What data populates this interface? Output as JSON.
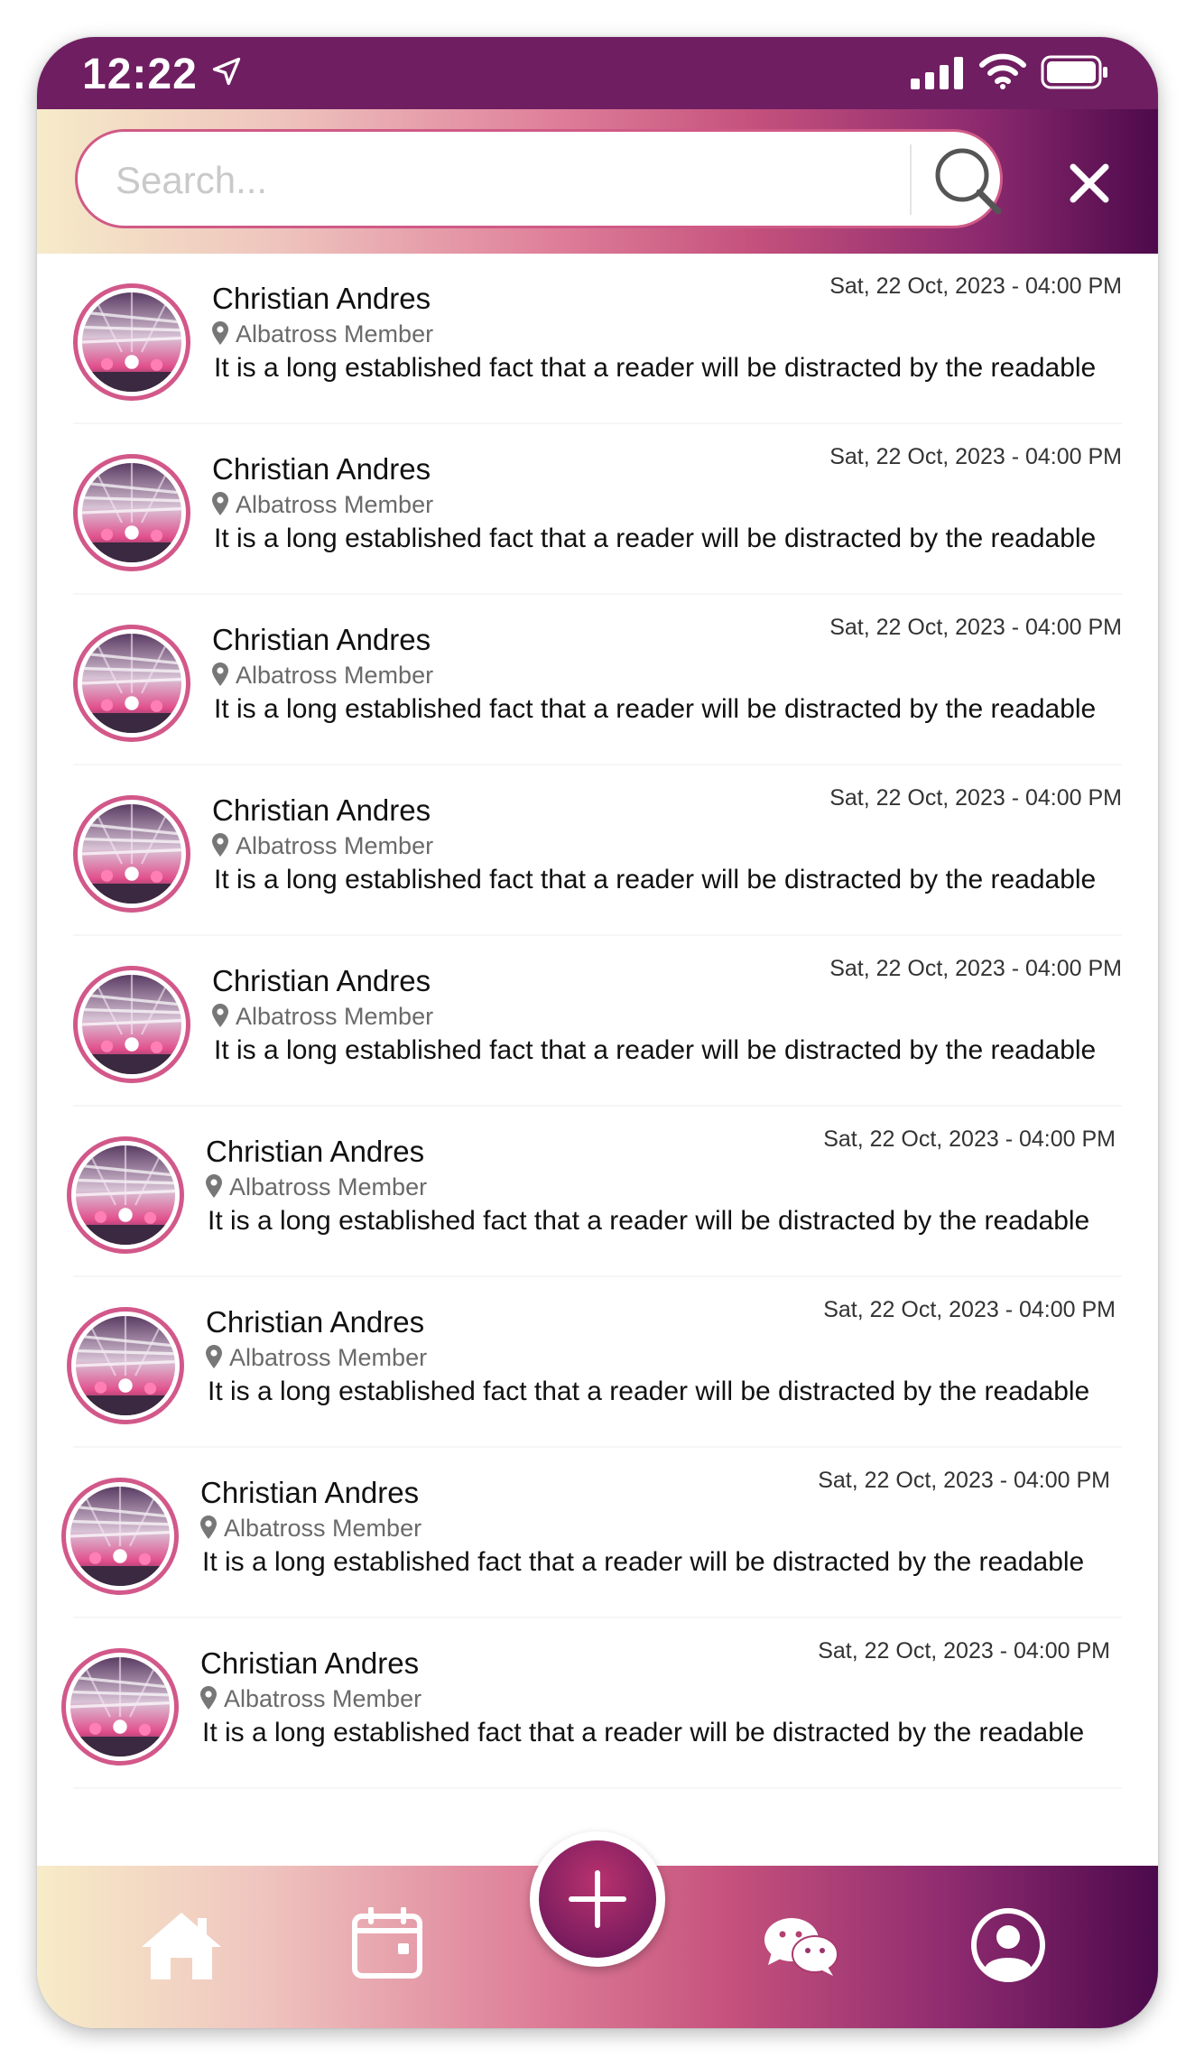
{
  "status_bar": {
    "time": "12:22"
  },
  "search": {
    "placeholder": "Search..."
  },
  "messages": [
    {
      "name": "Christian Andres",
      "role": "Albatross Member",
      "date": "Sat, 22 Oct, 2023 - 04:00 PM",
      "text": "It is a long established fact that a reader will be distracted by the readable"
    },
    {
      "name": "Christian Andres",
      "role": "Albatross Member",
      "date": "Sat, 22 Oct, 2023 - 04:00 PM",
      "text": "It is a long established fact that a reader will be distracted by the readable"
    },
    {
      "name": "Christian Andres",
      "role": "Albatross Member",
      "date": "Sat, 22 Oct, 2023 - 04:00 PM",
      "text": "It is a long established fact that a reader will be distracted by the readable"
    },
    {
      "name": "Christian Andres",
      "role": "Albatross Member",
      "date": "Sat, 22 Oct, 2023 - 04:00 PM",
      "text": "It is a long established fact that a reader will be distracted by the readable"
    },
    {
      "name": "Christian Andres",
      "role": "Albatross Member",
      "date": "Sat, 22 Oct, 2023 - 04:00 PM",
      "text": "It is a long established fact that a reader will be distracted by the readable"
    },
    {
      "name": "Christian Andres",
      "role": "Albatross Member",
      "date": "Sat, 22 Oct, 2023 - 04:00 PM",
      "text": "It is a long established fact that a reader will be distracted by the readable"
    },
    {
      "name": "Christian Andres",
      "role": "Albatross Member",
      "date": "Sat, 22 Oct, 2023 - 04:00 PM",
      "text": "It is a long established fact that a reader will be distracted by the readable"
    },
    {
      "name": "Christian Andres",
      "role": "Albatross Member",
      "date": "Sat, 22 Oct, 2023 - 04:00 PM",
      "text": "It is a long established fact that a reader will be distracted by the readable"
    },
    {
      "name": "Christian Andres",
      "role": "Albatross Member",
      "date": "Sat, 22 Oct, 2023 - 04:00 PM",
      "text": "It is a long established fact that a reader will be distracted by the readable"
    }
  ],
  "nav": {
    "items": [
      {
        "icon": "home-icon"
      },
      {
        "icon": "calendar-icon"
      },
      {
        "icon": "add-icon"
      },
      {
        "icon": "chat-icon"
      },
      {
        "icon": "profile-icon"
      }
    ]
  },
  "colors": {
    "primary": "#6f1e61",
    "accent_pink": "#d2588a",
    "gradient_start": "#f6ebc9",
    "gradient_end": "#4d0a4c"
  }
}
